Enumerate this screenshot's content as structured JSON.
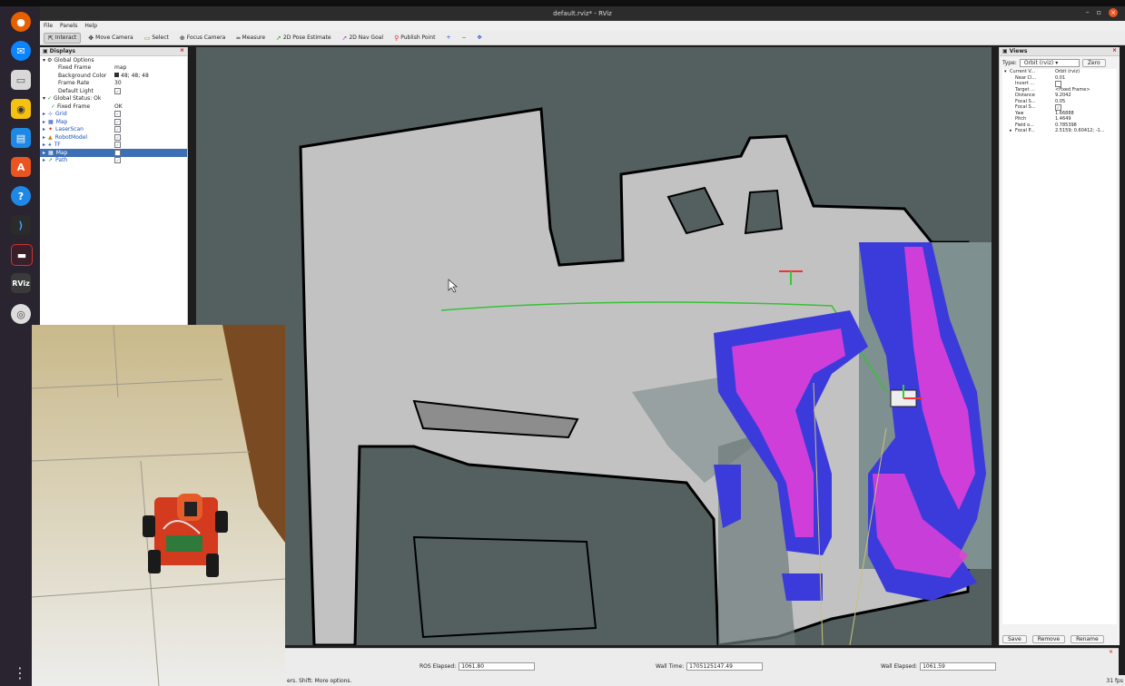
{
  "window": {
    "title": "default.rviz* - RViz",
    "minimize": "–",
    "restore": "▫",
    "close": "×"
  },
  "menu": [
    "File",
    "Panels",
    "Help"
  ],
  "toolbar": {
    "tools": [
      "Interact",
      "Move Camera",
      "Select",
      "Focus Camera",
      "Measure",
      "2D Pose Estimate",
      "2D Nav Goal",
      "Publish Point"
    ],
    "extra": [
      "+",
      "−",
      "✥"
    ]
  },
  "displays": {
    "title": "Displays",
    "close": "×",
    "global_options_label": "Global Options",
    "props": [
      {
        "k": "Fixed Frame",
        "v": "map"
      },
      {
        "k": "Background Color",
        "v": "48; 48; 48"
      },
      {
        "k": "Frame Rate",
        "v": "30"
      },
      {
        "k": "Default Light",
        "v": "✓"
      }
    ],
    "global_status": "Global Status: Ok",
    "fixed_frame": {
      "k": "Fixed Frame",
      "v": "OK"
    },
    "items": [
      "Grid",
      "Map",
      "LaserScan",
      "RobotModel",
      "TF",
      "Map",
      "Path"
    ]
  },
  "views": {
    "title": "Views",
    "close": "×",
    "type_label": "Type:",
    "type_value": "Orbit (rviz)",
    "zero_button": "Zero",
    "current_view": {
      "k": "Current V...",
      "v": "Orbit (rviz)"
    },
    "props": [
      {
        "k": "Near Cl...",
        "v": "0.01"
      },
      {
        "k": "Invert ...",
        "v": ""
      },
      {
        "k": "Target ...",
        "v": "<Fixed Frame>"
      },
      {
        "k": "Distance",
        "v": "9.2042"
      },
      {
        "k": "Focal S...",
        "v": "0.05"
      },
      {
        "k": "Focal S...",
        "v": "✓"
      },
      {
        "k": "Yaw",
        "v": "1.66888"
      },
      {
        "k": "Pitch",
        "v": "1.4649"
      },
      {
        "k": "Field o...",
        "v": "0.785398"
      },
      {
        "k": "Focal P...",
        "v": "2.5159; 0.60412; -1..."
      }
    ],
    "buttons": [
      "Save",
      "Remove",
      "Rename"
    ]
  },
  "time": {
    "ros_elapsed_label": "ROS Elapsed:",
    "ros_elapsed": "1061.80",
    "wall_time_label": "Wall Time:",
    "wall_time": "1705125147.49",
    "wall_elapsed_label": "Wall Elapsed:",
    "wall_elapsed": "1061.59",
    "close": "×"
  },
  "status": {
    "hint": "ers. Shift: More options.",
    "fps": "31 fps"
  },
  "dock": [
    "Firefox",
    "Thunderbird",
    "Files",
    "Rhythmbox",
    "Writer",
    "App Center",
    "Help",
    "VS Code",
    "Terminal",
    "RViz",
    "Disc"
  ],
  "dock_rviz_label": "RViz"
}
